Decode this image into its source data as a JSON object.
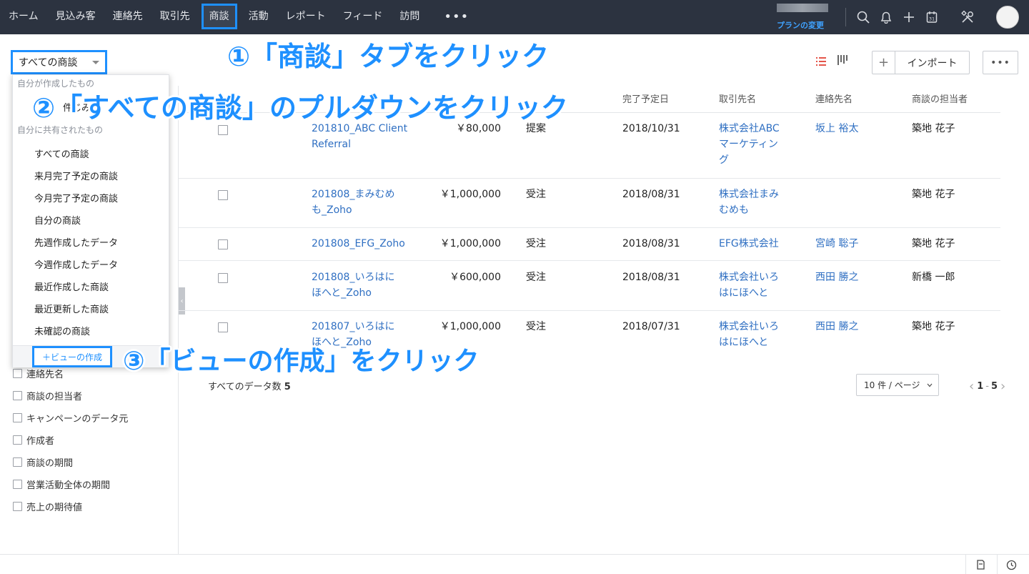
{
  "nav": {
    "items": [
      "ホーム",
      "見込み客",
      "連絡先",
      "取引先",
      "商談",
      "活動",
      "レポート",
      "フィード",
      "訪問"
    ],
    "active_index": 4,
    "more": "•••",
    "plan_link": "プランの変更",
    "icons": [
      "search-icon",
      "bell-icon",
      "plus-icon",
      "calendar-icon",
      "tools-icon"
    ],
    "calendar_day": "31"
  },
  "toolbar": {
    "view_select_label": "すべての商談",
    "import_label": "インポート",
    "plus_label": "+",
    "more_label": "•••"
  },
  "annotations": {
    "step1": "①「商談」タブをクリック",
    "step2": "②「すべての商談」のプルダウンをクリック",
    "step3": "③「ビューの作成」をクリック"
  },
  "dropdown": {
    "group_own": "自分が作成したもの",
    "own_partial": "件じみ",
    "group_shared": "自分に共有されたもの",
    "items": [
      "すべての商談",
      "来月完了予定の商談",
      "今月完了予定の商談",
      "自分の商談",
      "先週作成したデータ",
      "今週作成したデータ",
      "最近作成した商談",
      "最近更新した商談",
      "未確認の商談"
    ],
    "create_view": "＋ビューの作成"
  },
  "filters": [
    "連絡先名",
    "商談の担当者",
    "キャンペーンのデータ元",
    "作成者",
    "商談の期間",
    "営業活動全体の期間",
    "売上の期待値"
  ],
  "table": {
    "headers": {
      "close_date": "完了予定日",
      "account": "取引先名",
      "contact": "連絡先名",
      "owner": "商談の担当者"
    },
    "rows": [
      {
        "name": "201810_ABC Client\nReferral",
        "amount": "￥80,000",
        "stage": "提案",
        "date": "2018/10/31",
        "account": "株式会社ABC\nマーケティン\nグ",
        "contact": "坂上 裕太",
        "owner": "築地 花子"
      },
      {
        "name": "201808_まみむめ\nも_Zoho",
        "amount": "￥1,000,000",
        "stage": "受注",
        "date": "2018/08/31",
        "account": "株式会社まみ\nむめも",
        "contact": "",
        "owner": "築地 花子"
      },
      {
        "name": "201808_EFG_Zoho",
        "amount": "￥1,000,000",
        "stage": "受注",
        "date": "2018/08/31",
        "account": "EFG株式会社",
        "contact": "宮崎 聡子",
        "owner": "築地 花子"
      },
      {
        "name": "201808_いろはに\nほへと_Zoho",
        "amount": "￥600,000",
        "stage": "受注",
        "date": "2018/08/31",
        "account": "株式会社いろ\nはにほへと",
        "contact": "西田 勝之",
        "owner": "新橋 一郎"
      },
      {
        "name": "201807_いろはに\nほへと_Zoho",
        "amount": "￥1,000,000",
        "stage": "受注",
        "date": "2018/07/31",
        "account": "株式会社いろ\nはにほへと",
        "contact": "西田 勝之",
        "owner": "築地 花子"
      }
    ]
  },
  "footer": {
    "total_label": "すべてのデータ数",
    "total_count": "5",
    "per_page": "10 件 / ページ",
    "page_range_start": "1",
    "page_range_sep": "-",
    "page_range_end": "5"
  },
  "colors": {
    "nav_bg": "#2c3340",
    "highlight": "#1e90ff",
    "link": "#2f6fc2"
  }
}
